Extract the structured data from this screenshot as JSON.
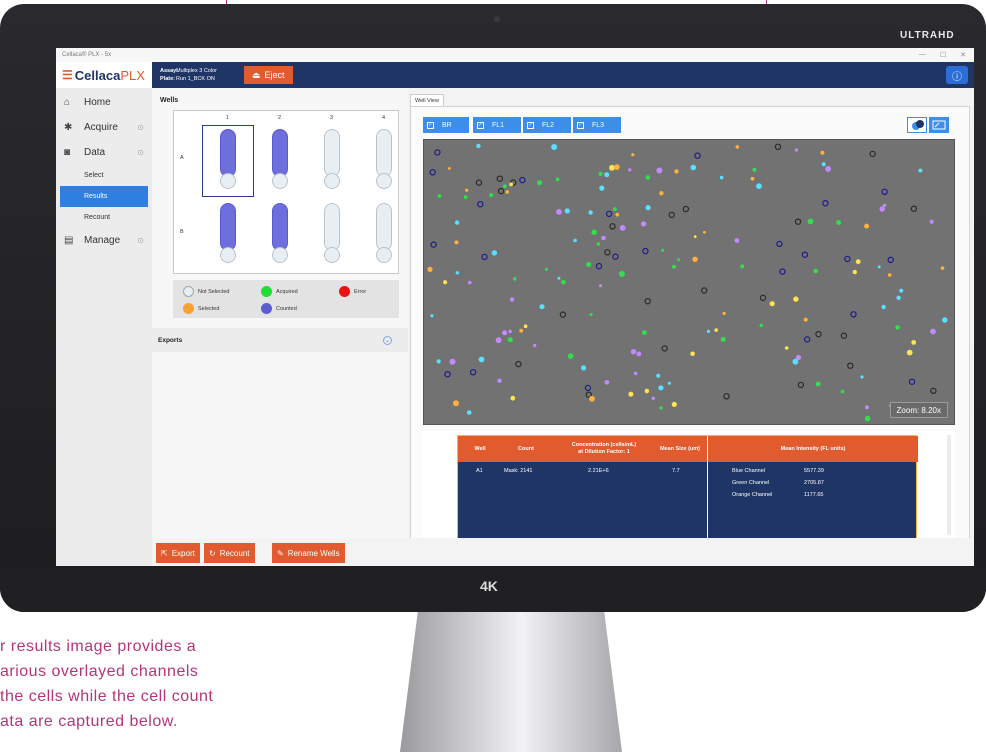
{
  "monitor": {
    "brand_badge": "ULTRAHD",
    "chin_badge": "4K"
  },
  "caption": {
    "lines": [
      "r results image provides a",
      "arious overlayed channels",
      "the cells while the cell count",
      "ata are captured below."
    ]
  },
  "app": {
    "window_title": "Cellaca® PLX - 5x",
    "window_controls": [
      "—",
      "☐",
      "✕"
    ],
    "logo_text": "Cellaca",
    "logo_suffix": "PLX",
    "assay_label": "Assay:",
    "assay_value": "Multiplex 3 Color",
    "plate_label": "Plate:",
    "plate_value": "Run 1_BCK ON",
    "eject_label": "Eject"
  },
  "sidebar": {
    "home": "Home",
    "acquire": "Acquire",
    "data": "Data",
    "select": "Select",
    "results": "Results",
    "recount": "Recount",
    "manage": "Manage"
  },
  "wells": {
    "title": "Wells",
    "columns": [
      "1",
      "2",
      "3",
      "4"
    ],
    "rows": [
      "A",
      "B"
    ],
    "legend": {
      "not_selected": "Not Selected",
      "acquired": "Acquired",
      "error": "Error",
      "selected": "Selected",
      "counted": "Counted"
    },
    "legend_colors": {
      "not_selected": "#e9eef3",
      "acquired": "#22dd33",
      "error": "#ee1111",
      "selected": "#f7a133",
      "counted": "#5c5cd6"
    }
  },
  "exports": {
    "label": "Exports"
  },
  "well_view": {
    "tab": "Well View",
    "channels": [
      "BR",
      "FL1",
      "FL2",
      "FL3"
    ],
    "zoom": "Zoom: 8.20x"
  },
  "results": {
    "headers": {
      "well": "Well",
      "count": "Count",
      "concentration": "Concentration (cells/mL)",
      "dilution": "at Dilution Factor:  1",
      "mean_size": "Mean Size (um)",
      "mean_intensity": "Mean Intensity (FL units)"
    },
    "row": {
      "well": "A1",
      "count": "Mask:  2141",
      "concentration": "2.21E+6",
      "mean_size": "7.7"
    },
    "intensities": [
      {
        "channel": "Blue Channel",
        "value": "5577.39"
      },
      {
        "channel": "Green Channel",
        "value": "2705.87"
      },
      {
        "channel": "Orange Channel",
        "value": "1177.65"
      }
    ]
  },
  "actions": {
    "export": "Export",
    "recount": "Recount",
    "rename": "Rename Wells"
  },
  "colors": {
    "accent_orange": "#e25b2f",
    "nav_blue": "#1f3566",
    "channel_blue": "#3c8ee8"
  }
}
